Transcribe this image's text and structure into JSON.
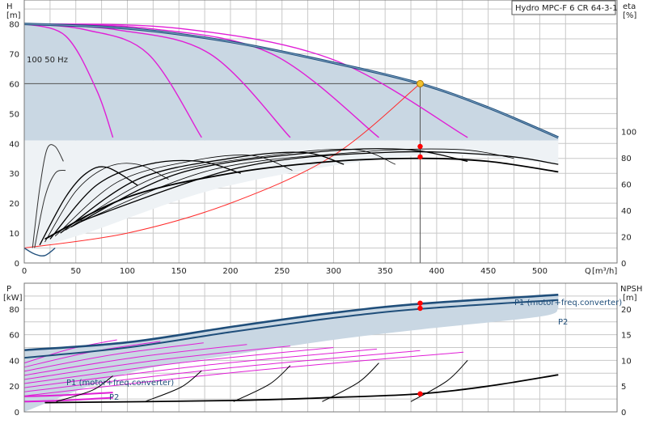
{
  "product_label": "Hydro MPC-F 6 CR 64-3-1",
  "colors": {
    "envelope_fill": "#c9d7e3",
    "rated_curve": "#1f4e7a",
    "speed_curves": "#e01fd6",
    "efficiency_curves": "#000000",
    "system_curve": "#ff2a2a",
    "grid": "#c8c8c8",
    "duty_point": "#f2c12e",
    "markers": "#ff0000"
  },
  "chart_data": [
    {
      "type": "line",
      "name": "head-efficiency",
      "ylabel": "H",
      "yunit": "[m]",
      "xlabel": "Q",
      "xunit": "[m³/h]",
      "x_ticks": [
        0,
        50,
        100,
        150,
        200,
        250,
        300,
        350,
        400,
        450,
        500
      ],
      "y_ticks": [
        0,
        10,
        20,
        30,
        40,
        50,
        60,
        70,
        80
      ],
      "xlim": [
        0,
        575
      ],
      "ylim": [
        0,
        88
      ],
      "y2label": "eta",
      "y2unit": "[%]",
      "y2_ticks": [
        0,
        20,
        40,
        60,
        80,
        100
      ],
      "y2lim": [
        0,
        200
      ],
      "speed_label": "100 50 Hz",
      "envelope_top": [
        [
          0,
          80
        ],
        [
          100,
          78.5
        ],
        [
          200,
          74
        ],
        [
          300,
          67
        ],
        [
          384,
          60
        ],
        [
          450,
          52
        ],
        [
          518,
          42
        ]
      ],
      "envelope_floor": 41,
      "speed_curves": [
        {
          "q_end": 86,
          "points": [
            [
              0,
              80
            ],
            [
              40,
              76
            ],
            [
              70,
              58
            ],
            [
              86,
              42
            ]
          ]
        },
        {
          "q_end": 172,
          "points": [
            [
              0,
              80
            ],
            [
              60,
              78
            ],
            [
              120,
              70
            ],
            [
              172,
              42
            ]
          ]
        },
        {
          "q_end": 258,
          "points": [
            [
              0,
              80
            ],
            [
              90,
              78
            ],
            [
              180,
              70
            ],
            [
              258,
              42
            ]
          ]
        },
        {
          "q_end": 344,
          "points": [
            [
              0,
              80
            ],
            [
              120,
              78.5
            ],
            [
              240,
              70
            ],
            [
              344,
              42
            ]
          ]
        },
        {
          "q_end": 430,
          "points": [
            [
              0,
              80
            ],
            [
              150,
              78.5
            ],
            [
              300,
              68
            ],
            [
              430,
              42
            ]
          ]
        }
      ],
      "system_curve": [
        [
          0,
          5
        ],
        [
          100,
          10
        ],
        [
          200,
          20
        ],
        [
          300,
          36
        ],
        [
          384,
          60
        ]
      ],
      "duty_point": {
        "q": 384,
        "h": 60
      },
      "efficiency_max_curve": [
        [
          20,
          8
        ],
        [
          100,
          22
        ],
        [
          200,
          30
        ],
        [
          300,
          34
        ],
        [
          384,
          35
        ],
        [
          450,
          34
        ],
        [
          518,
          30.5
        ]
      ],
      "efficiency_markers": [
        {
          "q": 384,
          "h": 39
        },
        {
          "q": 384,
          "h": 35.5
        }
      ]
    },
    {
      "type": "line",
      "name": "power-npsh",
      "ylabel": "P",
      "yunit": "[kW]",
      "y_ticks": [
        0,
        20,
        40,
        60,
        80
      ],
      "ylim": [
        0,
        100
      ],
      "y2label": "NPSH",
      "y2unit": "[m]",
      "y2_ticks": [
        0,
        5,
        10,
        15,
        20
      ],
      "y2lim": [
        0,
        25
      ],
      "series_labels": [
        "P1 (motor+freq.converter)",
        "P2",
        "P1 (motor+freq.converter)",
        "P2"
      ],
      "p1_total": [
        [
          0,
          48
        ],
        [
          100,
          54
        ],
        [
          200,
          66
        ],
        [
          300,
          77
        ],
        [
          384,
          84
        ],
        [
          518,
          91
        ]
      ],
      "p2_total": [
        [
          0,
          42
        ],
        [
          100,
          50
        ],
        [
          200,
          62
        ],
        [
          300,
          73
        ],
        [
          384,
          80
        ],
        [
          518,
          87
        ]
      ],
      "npsh": [
        [
          20,
          1.8
        ],
        [
          200,
          2.2
        ],
        [
          300,
          2.8
        ],
        [
          384,
          3.5
        ],
        [
          450,
          5.0
        ],
        [
          518,
          7.2
        ]
      ],
      "markers": [
        {
          "q": 384,
          "p": 84.5
        },
        {
          "q": 384,
          "p": 80.5
        },
        {
          "q": 384,
          "npsh": 3.5
        }
      ]
    }
  ]
}
